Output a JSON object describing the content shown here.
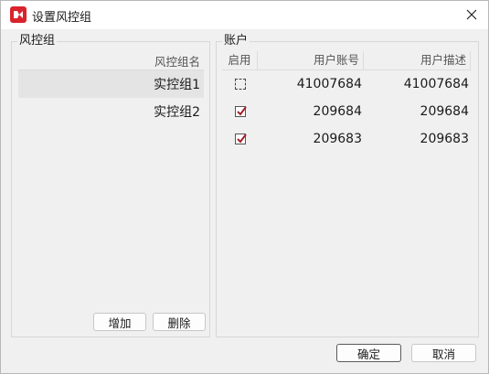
{
  "window": {
    "title": "设置风控组"
  },
  "left_group": {
    "label": "风控组",
    "header": "风控组名",
    "rows": [
      "实控组1",
      "实控组2"
    ],
    "add_label": "增加",
    "delete_label": "删除"
  },
  "right_group": {
    "label": "账户",
    "headers": {
      "enabled": "启用",
      "account": "用户账号",
      "desc": "用户描述"
    },
    "rows": [
      {
        "enabled": false,
        "account": "41007684",
        "desc": "41007684"
      },
      {
        "enabled": true,
        "account": "209684",
        "desc": "209684"
      },
      {
        "enabled": true,
        "account": "209683",
        "desc": "209683"
      }
    ]
  },
  "footer": {
    "ok_label": "确定",
    "cancel_label": "取消"
  },
  "colors": {
    "app_icon": "#d9232d",
    "check": "#a3202a"
  },
  "icons": {
    "app": "app-logo-icon",
    "close": "close-icon",
    "check": "checkmark-icon"
  }
}
